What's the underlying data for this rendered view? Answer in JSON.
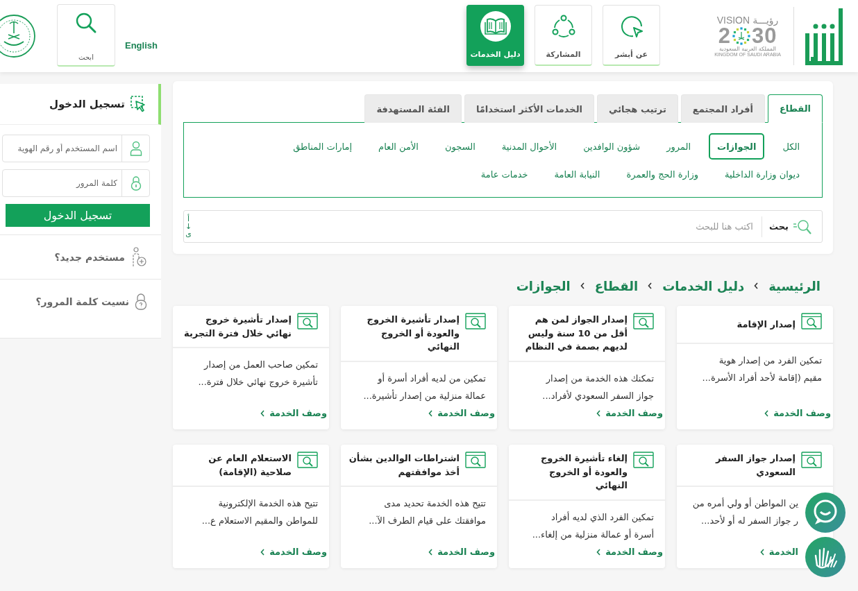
{
  "header": {
    "absher_logo": {
      "kind": "logo"
    },
    "vision_logo": {
      "title_ar": "رؤيـــة",
      "title": "VISION",
      "year_digit": "2",
      "year_tail": "30",
      "country_ar": "المملكة العربية السعودية",
      "country_en": "KINGDOM OF SAUDI ARABIA"
    },
    "nav": [
      {
        "label": "عن أبشر",
        "kind": "pointer",
        "selected": false
      },
      {
        "label": "المشاركة",
        "kind": "network",
        "selected": false
      },
      {
        "label": "دليل الخدمات",
        "kind": "book",
        "selected": true
      }
    ],
    "language_link": "English",
    "search_button": {
      "label": "ابحث"
    }
  },
  "login": {
    "title": "تسجيل الدخول",
    "username_placeholder": "اسم المستخدم أو رقم الهوية",
    "password_placeholder": "كلمة المرور",
    "submit": "تسجيل الدخول",
    "links": [
      {
        "label": "مستخدم جديد؟",
        "kind": "register"
      },
      {
        "label": "نسيت كلمة المرور؟",
        "kind": "recover"
      }
    ]
  },
  "tabs": [
    {
      "label": "القطاع",
      "selected": true
    },
    {
      "label": "أفراد المجتمع",
      "selected": false
    },
    {
      "label": "ترتيب هجائي",
      "selected": false
    },
    {
      "label": "الخدمات الأكثر استخدامًا",
      "selected": false
    },
    {
      "label": "الفئة المستهدفة",
      "selected": false
    }
  ],
  "sectors": [
    {
      "label": "الكل",
      "selected": false
    },
    {
      "label": "الجوازات",
      "selected": true
    },
    {
      "label": "المرور",
      "selected": false
    },
    {
      "label": "شؤون الوافدين",
      "selected": false
    },
    {
      "label": "الأحوال المدنية",
      "selected": false
    },
    {
      "label": "السجون",
      "selected": false
    },
    {
      "label": "الأمن العام",
      "selected": false
    },
    {
      "label": "إمارات المناطق",
      "selected": false
    },
    {
      "label": "ديوان وزارة الداخلية",
      "selected": false
    },
    {
      "label": "وزارة الحج والعمرة",
      "selected": false
    },
    {
      "label": "النيابة العامة",
      "selected": false
    },
    {
      "label": "خدمات عامة",
      "selected": false
    }
  ],
  "search": {
    "label": "بحث",
    "placeholder": "اكتب هنا للبحث",
    "sort_toggle": [
      "أ",
      "↓",
      "ى"
    ]
  },
  "breadcrumb": [
    "الرئيسية",
    "دليل الخدمات",
    "القطاع",
    "الجوازات"
  ],
  "services": [
    {
      "title": "إصدار الإقامة",
      "description_lines": [
        "تمكين الفرد من إصدار هوية",
        "مقيم (إقامة لأحد أفراد الأسرة..."
      ],
      "link": "وصف الخدمة"
    },
    {
      "title": "إصدار الجواز لمن هم أقل من 10 سنة وليس لديهم بصمة في النظام",
      "description_lines": [
        "تمكنك هذه الخدمة من إصدار",
        "جواز السفر السعودي لأفراد..."
      ],
      "link": "وصف الخدمة"
    },
    {
      "title": "إصدار تأشيرة الخروج والعودة أو الخروج النهائي",
      "description_lines": [
        "تمكين من لديه أفراد أسرة أو",
        "عمالة منزلية من إصدار تأشيرة..."
      ],
      "link": "وصف الخدمة"
    },
    {
      "title": "إصدار تأشيرة خروج نهائي خلال فترة التجربة",
      "description_lines": [
        "تمكين صاحب العمل من إصدار",
        "تأشيرة خروج نهائي خلال فترة..."
      ],
      "link": "وصف الخدمة"
    },
    {
      "title": "إصدار جواز السفر السعودي",
      "description_lines": [
        "ين المواطن أو ولي أمره من",
        "ر جواز السفر له أو لأحد..."
      ],
      "link": "الخدمة"
    },
    {
      "title": "إلغاء تأشيرة الخروج والعودة أو الخروج النهائي",
      "description_lines": [
        "تمكين الفرد الذي لديه أفراد",
        "أسرة أو عمالة منزلية من إلغاء..."
      ],
      "link": "وصف الخدمة"
    },
    {
      "title": "اشتراطات الوالدين بشأن أخذ موافقتهم",
      "description_lines": [
        "تتيح هذه الخدمة تحديد مدى",
        "موافقتك على قيام الطرف الآ..."
      ],
      "link": "وصف الخدمة"
    },
    {
      "title": "الاستعلام العام عن صلاحية (الإقامة)",
      "description_lines": [
        "تتيح هذه الخدمة الإلكترونية",
        "للمواطن والمقيم الاستعلام ع..."
      ],
      "link": "وصف الخدمة"
    }
  ],
  "floating_buttons": [
    {
      "kind": "support"
    },
    {
      "kind": "sign-language"
    }
  ]
}
